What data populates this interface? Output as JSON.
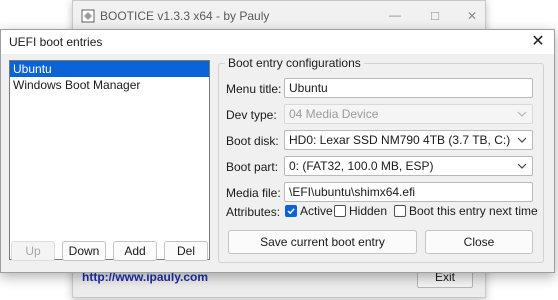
{
  "main_window": {
    "title": "BOOTICE v1.3.3 x64 - by Pauly",
    "url": "http://www.ipauly.com",
    "exit_label": "Exit"
  },
  "dialog": {
    "title": "UEFI boot entries",
    "entries": [
      "Ubuntu",
      "Windows Boot Manager"
    ],
    "selected_index": 0,
    "buttons": {
      "up": "Up",
      "down": "Down",
      "add": "Add",
      "del": "Del"
    },
    "config": {
      "group_title": "Boot entry configurations",
      "menu_title_label": "Menu title:",
      "menu_title_value": "Ubuntu",
      "dev_type_label": "Dev type:",
      "dev_type_value": "04  Media Device",
      "boot_disk_label": "Boot disk:",
      "boot_disk_value": "HD0: Lexar SSD NM790 4TB (3.7 TB, C:)",
      "boot_part_label": "Boot part:",
      "boot_part_value": "0: (FAT32, 100.0 MB, ESP)",
      "media_file_label": "Media file:",
      "media_file_value": "\\EFI\\ubuntu\\shimx64.efi",
      "attributes_label": "Attributes:",
      "active_label": "Active",
      "active_checked": true,
      "hidden_label": "Hidden",
      "hidden_checked": false,
      "next_time_label": "Boot this entry next time",
      "next_time_checked": false,
      "save_label": "Save current boot entry",
      "close_label": "Close"
    }
  }
}
